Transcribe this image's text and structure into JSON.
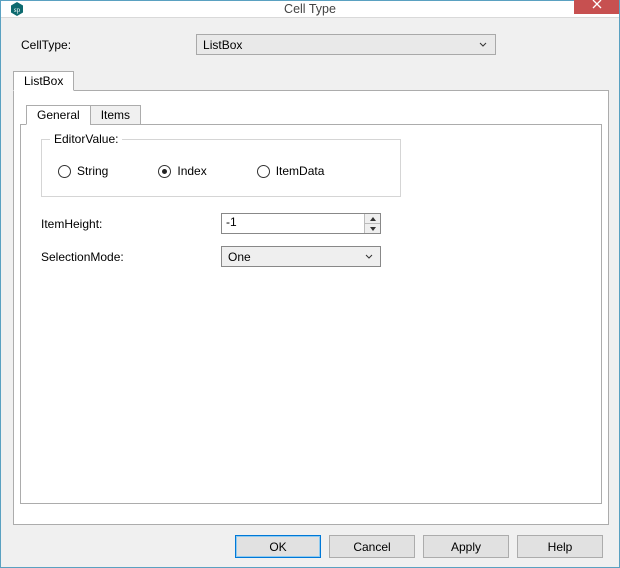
{
  "window": {
    "title": "Cell Type"
  },
  "form": {
    "celltype_label": "CellType:",
    "celltype_value": "ListBox"
  },
  "outerTabs": {
    "tab0": "ListBox"
  },
  "innerTabs": {
    "tab0": "General",
    "tab1": "Items"
  },
  "editorValue": {
    "legend": "EditorValue:",
    "opt_string": "String",
    "opt_index": "Index",
    "opt_itemdata": "ItemData",
    "selected": "Index"
  },
  "fields": {
    "itemheight_label": "ItemHeight:",
    "itemheight_value": "-1",
    "selectionmode_label": "SelectionMode:",
    "selectionmode_value": "One"
  },
  "buttons": {
    "ok": "OK",
    "cancel": "Cancel",
    "apply": "Apply",
    "help": "Help"
  }
}
